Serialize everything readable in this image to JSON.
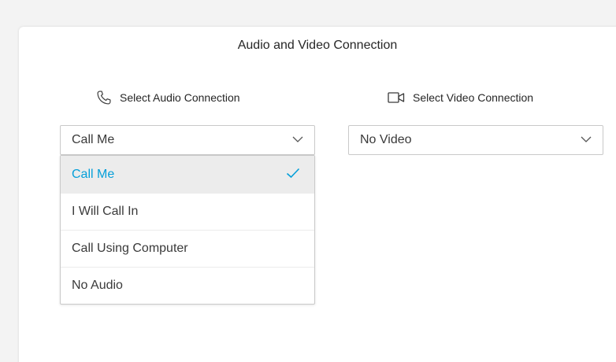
{
  "dialog": {
    "title": "Audio and Video Connection"
  },
  "audio": {
    "label": "Select Audio Connection",
    "icon": "phone-icon",
    "selected": "Call Me",
    "options": [
      {
        "label": "Call Me",
        "selected": true
      },
      {
        "label": "I Will Call In",
        "selected": false
      },
      {
        "label": "Call Using Computer",
        "selected": false
      },
      {
        "label": "No Audio",
        "selected": false
      }
    ]
  },
  "video": {
    "label": "Select Video Connection",
    "icon": "video-camera-icon",
    "selected": "No Video"
  },
  "colors": {
    "accent": "#049fd9",
    "selected_bg": "#ececec",
    "border": "#c9c9c9",
    "text": "#262626"
  }
}
